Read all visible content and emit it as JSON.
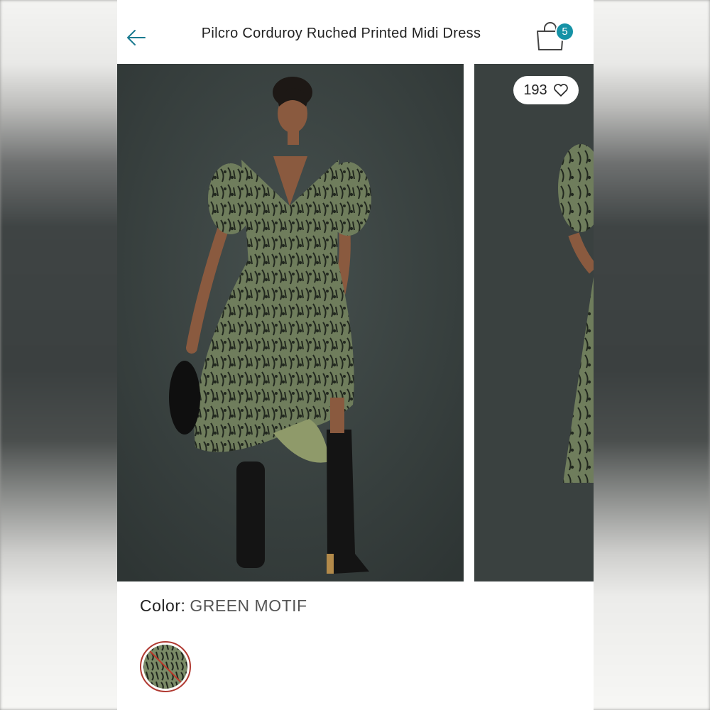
{
  "header": {
    "title": "Pilcro Corduroy Ruched Printed Midi Dress",
    "bag_count": "5"
  },
  "gallery": {
    "likes": "193"
  },
  "color": {
    "label": "Color:",
    "value": "GREEN MOTIF"
  },
  "colors": {
    "accent": "#1592a6",
    "background_photo": "#3a4140",
    "dress_green": "#6f7d5c",
    "swatch_strike": "#c0392b"
  },
  "icons": [
    "back-arrow-icon",
    "shopping-bag-icon",
    "heart-icon",
    "color-swatch"
  ]
}
